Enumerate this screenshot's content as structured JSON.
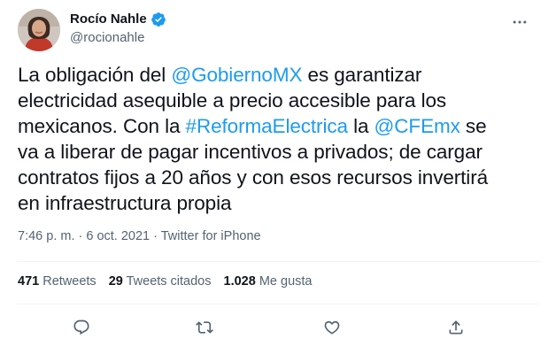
{
  "author": {
    "display_name": "Rocío Nahle",
    "handle": "@rocionahle",
    "verified": true
  },
  "tweet": {
    "lines": [
      [
        {
          "t": "La obligación del ",
          "k": "text"
        },
        {
          "t": "@GobiernoMX",
          "k": "mention"
        },
        {
          "t": " es garantizar",
          "k": "text"
        }
      ],
      [
        {
          "t": "electricidad asequible a precio accesible para los",
          "k": "text"
        }
      ],
      [
        {
          "t": "mexicanos. Con la ",
          "k": "text"
        },
        {
          "t": "#ReformaElectrica",
          "k": "hashtag"
        },
        {
          "t": " la ",
          "k": "text"
        },
        {
          "t": "@CFEmx",
          "k": "mention"
        },
        {
          "t": " se",
          "k": "text"
        }
      ],
      [
        {
          "t": "va a liberar de pagar incentivos a privados; de cargar",
          "k": "text"
        }
      ],
      [
        {
          "t": "contratos fijos a 20 años y con esos recursos invertirá",
          "k": "text"
        }
      ],
      [
        {
          "t": "en infraestructura propia",
          "k": "text"
        }
      ]
    ]
  },
  "meta": {
    "time": "7:46 p. m.",
    "separator": " · ",
    "date": "6 oct. 2021",
    "source": "Twitter for iPhone"
  },
  "stats": {
    "retweets_count": "471",
    "retweets_label": " Retweets",
    "quotes_count": "29",
    "quotes_label": " Tweets citados",
    "likes_count": "1.028",
    "likes_label": " Me gusta"
  },
  "icons": {
    "more": "more-horizontal-icon",
    "reply": "reply-icon",
    "retweet": "retweet-icon",
    "like": "heart-icon",
    "share": "share-icon",
    "verified": "verified-badge-icon"
  },
  "colors": {
    "link": "#1d9bf0",
    "text": "#0f1419",
    "secondary": "#536471",
    "divider": "#eff3f4"
  }
}
